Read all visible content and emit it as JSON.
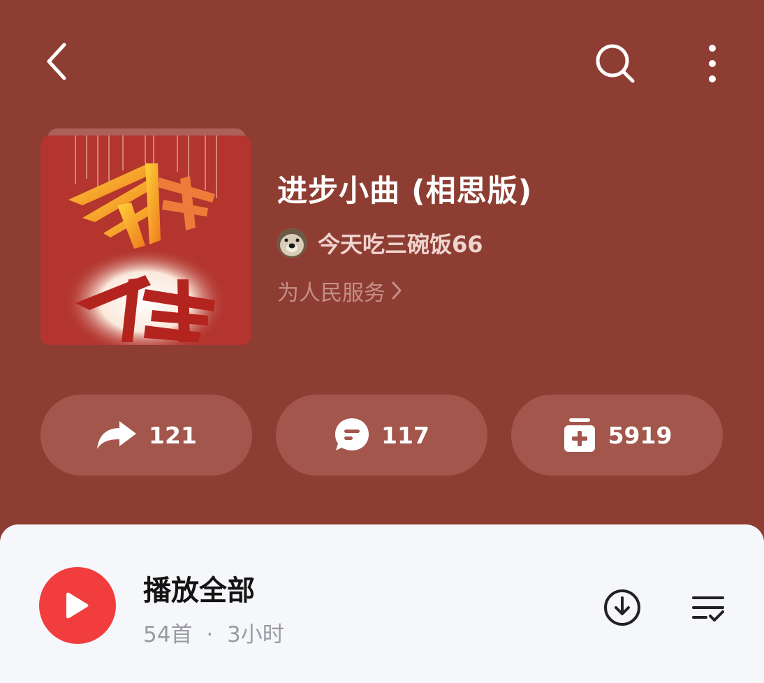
{
  "playlist": {
    "title": "进步小曲 (相思版)",
    "creator_name": "今天吃三碗饭66",
    "description": "为人民服务"
  },
  "stats": {
    "share_count": "121",
    "comment_count": "117",
    "collect_count": "5919"
  },
  "play_section": {
    "title": "播放全部",
    "count": "54首",
    "separator": "·",
    "duration": "3小时"
  },
  "icons": {
    "back": "back-arrow-icon",
    "search": "search-icon",
    "more": "more-vertical-icon",
    "share": "share-icon",
    "comment": "comment-icon",
    "collect": "collect-add-icon",
    "play": "play-icon",
    "download": "download-icon",
    "manage": "list-manage-icon"
  },
  "colors": {
    "header_bg": "#8e3d33",
    "pill_bg": "#a3564c",
    "play_red": "#f13d3d",
    "panel_bg": "#f6f7fb"
  }
}
